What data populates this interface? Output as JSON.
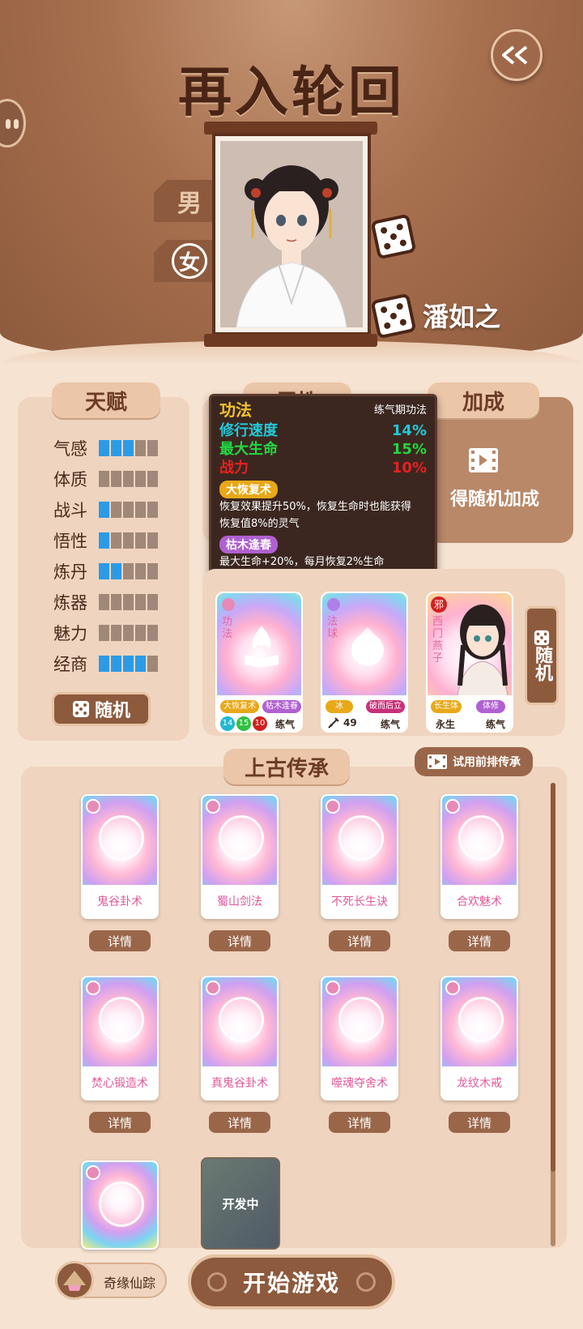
{
  "header": {
    "title": "再入轮回"
  },
  "gender": {
    "male": "男",
    "female": "女"
  },
  "character": {
    "name": "潘如之"
  },
  "tabs": {
    "talent": "天赋",
    "attribute": "属性",
    "bonus": "加成"
  },
  "talents": [
    {
      "label": "气感",
      "level": 3
    },
    {
      "label": "体质",
      "level": 0
    },
    {
      "label": "战斗",
      "level": 1
    },
    {
      "label": "悟性",
      "level": 1
    },
    {
      "label": "炼丹",
      "level": 2
    },
    {
      "label": "炼器",
      "level": 0
    },
    {
      "label": "魅力",
      "level": 0
    },
    {
      "label": "经商",
      "level": 4
    }
  ],
  "talent_random": "随机",
  "bonus": {
    "text": "得随机加成"
  },
  "tooltip": {
    "title": "功法",
    "stage": "练气期功法",
    "stats": [
      {
        "label": "修行速度",
        "value": "14%",
        "color": "#22c8d8"
      },
      {
        "label": "最大生命",
        "value": "15%",
        "color": "#22d840"
      },
      {
        "label": "战力",
        "value": "10%",
        "color": "#e82020"
      }
    ],
    "skill1": {
      "name": "大恢复术",
      "desc1": "恢复效果提升50%，恢复生命时也能获得",
      "desc2": "恢复值8%的灵气"
    },
    "skill2": {
      "name": "枯木逢春",
      "desc1": "最大生命+20%，每月恢复2%生命"
    }
  },
  "cards": {
    "gongfa": {
      "label": "功法",
      "pill1": "大恢复术",
      "pill2": "枯木逢春",
      "n1": "14",
      "n2": "15",
      "n3": "10",
      "stage": "练气"
    },
    "faqiu": {
      "label": "法球",
      "pill1": "冰",
      "pill2": "破而后立",
      "power": "49",
      "stage": "练气"
    },
    "companion": {
      "tag": "邪",
      "label": "西门燕子",
      "pill1": "长生体",
      "pill2": "体修",
      "left": "永生",
      "stage": "练气"
    }
  },
  "side_random": "随机",
  "legacy": {
    "title": "上古传承",
    "trial_button": "试用前排传承",
    "detail_label": "详情",
    "items": [
      "鬼谷卦术",
      "蜀山剑法",
      "不死长生诀",
      "合欢魅术",
      "焚心锻造术",
      "真鬼谷卦术",
      "噬魂夺舍术",
      "龙纹木戒"
    ],
    "dev_label": "开发中"
  },
  "footer": {
    "fortune": "奇缘仙踪",
    "start": "开始游戏"
  }
}
